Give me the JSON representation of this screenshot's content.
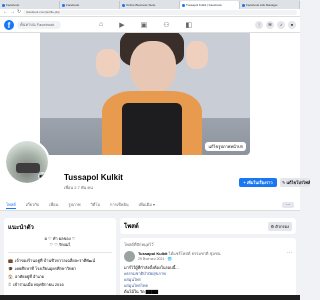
{
  "browser": {
    "tabs": [
      {
        "label": "Facebook"
      },
      {
        "label": "Facebook"
      },
      {
        "label": "Online Business Suite"
      },
      {
        "label": "Tussapol Kulkit | Facebook"
      },
      {
        "label": "Facebook Ads Manager"
      }
    ],
    "url": "facebook.com/profile.php"
  },
  "fbnav": {
    "logo": "f",
    "search_placeholder": "ค้นหาบน Facebook"
  },
  "profile": {
    "name": "Tussapol Kulkit",
    "friends": "เพื่อน 2.7 พัน คน",
    "add_story_label": "+ เพิ่มในเรื่องราว",
    "edit_profile_label": "✎ แก้ไขโปรไฟล์",
    "edit_cover_label": "แก้ไขรูปภาพหน้าปก"
  },
  "tabs": [
    {
      "label": "โพสต์",
      "active": true
    },
    {
      "label": "เกี่ยวกับ"
    },
    {
      "label": "เพื่อน"
    },
    {
      "label": "รูปภาพ"
    },
    {
      "label": "วิดีโอ"
    },
    {
      "label": "การเช็คอิน"
    },
    {
      "label": "เพิ่มเติม ▾"
    }
  ],
  "intro": {
    "title": "แนะนำตัว",
    "bio_line1": "ผ ♡ ทำ ผลของ ♡",
    "bio_line2": "♡ ♡ รักผมไ",
    "details": [
      {
        "icon": "💼",
        "text": "เจ้าของร้านอยู่ที่ บ้านชีวหวาลเฉลี่ยละราศีพัฒน์"
      },
      {
        "icon": "🎓",
        "text": "เคยศึกษาที่ โรงเรียนอุดรศึกษาวิทยา"
      },
      {
        "icon": "🏠",
        "text": "อาศัยอยู่ที่ อำเภอ"
      },
      {
        "icon": "⏱",
        "text": "เข้าร่วมเมื่อ พฤศจิกายน 2016"
      }
    ]
  },
  "posts": {
    "title": "โพสต์",
    "filter_label": "⚙ ตัวกรอง",
    "pinned_label": "โพสต์ที่ปักหมุดไว้",
    "post": {
      "author": "Tussapol Kulkit",
      "source": "ได้แชร์โพสต์ ธรรมชาติ ชุมชน",
      "date": "29 สิงหาคม 2021 · 🌐",
      "line1": "มาร์ไว้ผู้ที่กำลังตั้งท้องในรอบนี้...",
      "tag1": "#ธรรมชาติบำบัดสุขภาพ",
      "tag2": "#สมุนไพร",
      "tag3": "#สมุนไพรไทย",
      "line2": "ต้นไม้ใน วัด ▇▇▇▇"
    }
  },
  "colors": {
    "facebook_blue": "#1877f2",
    "background": "#f0f2f5"
  }
}
